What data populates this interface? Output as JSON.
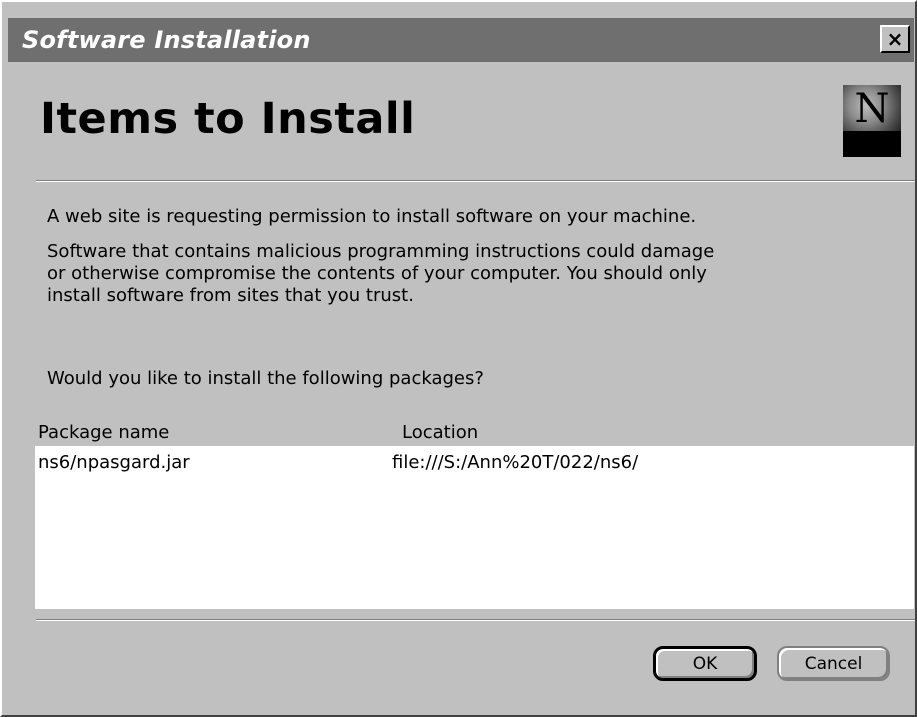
{
  "window": {
    "title": "Software Installation",
    "close_label": "×"
  },
  "header": {
    "heading": "Items to Install",
    "logo_letter": "N"
  },
  "body": {
    "paragraph1": "A web site is requesting permission to install software on your machine.",
    "paragraph2_lines": [
      "Software that contains malicious programming instructions could damage",
      "or otherwise compromise the contents of your computer. You should only",
      "install software from sites that you trust."
    ],
    "question": "Would you like to install the following packages?"
  },
  "packages": {
    "columns": [
      "Package name",
      "Location"
    ],
    "rows": [
      {
        "name": "ns6/npasgard.jar",
        "location": "file:///S:/Ann%20T/022/ns6/"
      }
    ]
  },
  "buttons": {
    "ok": "OK",
    "cancel": "Cancel"
  },
  "icons": {
    "close": "close-icon",
    "logo": "netscape-logo-icon"
  }
}
